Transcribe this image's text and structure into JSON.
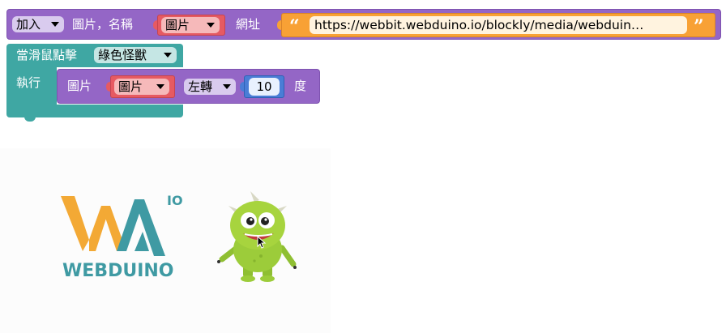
{
  "block_add_image": {
    "add_label": "加入",
    "image_name_label": "圖片，名稱",
    "image_name_value": "圖片",
    "url_label": "網址",
    "url_open_quote": "“",
    "url_value": "https://webbit.webduino.io/blockly/media/webduin…",
    "url_close_quote": "”"
  },
  "block_on_click": {
    "when_label": "當滑鼠點擊",
    "target_value": "綠色怪獸",
    "do_label": "執行"
  },
  "block_rotate": {
    "image_label": "圖片",
    "image_value": "圖片",
    "direction_value": "左轉",
    "degrees_value": "10",
    "degrees_unit": "度"
  },
  "stage": {
    "logo_text": "WEBDUINO",
    "logo_superscript": "IO"
  },
  "colors": {
    "logic_purple": "#9466c6",
    "event_teal": "#3fa7a3",
    "variable_red": "#e65a62",
    "text_orange": "#f8a135",
    "math_blue": "#4a7dd6",
    "logo_yellow": "#f3a935",
    "logo_teal": "#3f9aa3",
    "monster_green": "#9ccc3a"
  },
  "icons": [
    "dropdown-caret-icon",
    "mouse-pointer-icon",
    "monster-character",
    "webduino-logo"
  ]
}
